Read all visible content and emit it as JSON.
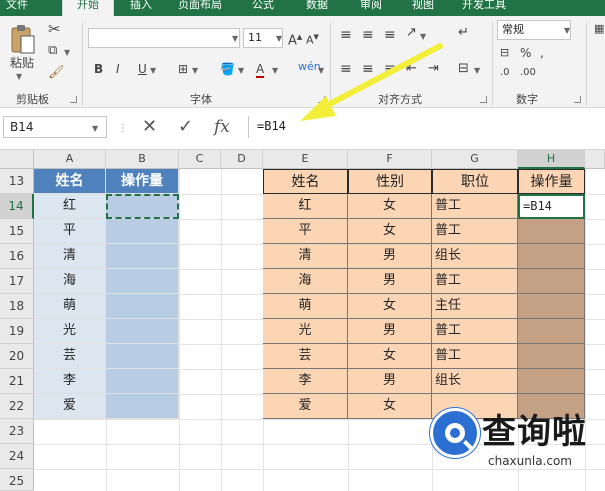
{
  "ribbon": {
    "tabs": [
      "文件",
      "开始",
      "插入",
      "页面布局",
      "公式",
      "数据",
      "审阅",
      "视图",
      "开发工具"
    ],
    "active_tab": "开始",
    "groups": {
      "clipboard": "剪贴板",
      "paste": "粘贴",
      "font": "字体",
      "alignment": "对齐方式",
      "number": "数字"
    },
    "font_size": "11",
    "number_format": "常规"
  },
  "formula_bar": {
    "name_box": "B14",
    "formula": "=B14",
    "fx_label": "fx"
  },
  "columns": [
    "A",
    "B",
    "C",
    "D",
    "E",
    "F",
    "G",
    "H"
  ],
  "selected_column": "H",
  "rows": [
    "13",
    "14",
    "15",
    "16",
    "17",
    "18",
    "19",
    "20",
    "21",
    "22",
    "23",
    "24",
    "25"
  ],
  "selected_row": "14",
  "left_table": {
    "headers": [
      "姓名",
      "操作量"
    ],
    "names": [
      "红",
      "平",
      "清",
      "海",
      "萌",
      "光",
      "芸",
      "李",
      "爱"
    ]
  },
  "right_table": {
    "headers": [
      "姓名",
      "性别",
      "职位",
      "操作量"
    ],
    "rows": [
      {
        "name": "红",
        "gender": "女",
        "title": "普工",
        "op": "=B14"
      },
      {
        "name": "平",
        "gender": "女",
        "title": "普工",
        "op": ""
      },
      {
        "name": "清",
        "gender": "男",
        "title": "组长",
        "op": ""
      },
      {
        "name": "海",
        "gender": "男",
        "title": "普工",
        "op": ""
      },
      {
        "name": "萌",
        "gender": "女",
        "title": "主任",
        "op": ""
      },
      {
        "name": "光",
        "gender": "男",
        "title": "普工",
        "op": ""
      },
      {
        "name": "芸",
        "gender": "女",
        "title": "普工",
        "op": ""
      },
      {
        "name": "李",
        "gender": "男",
        "title": "组长",
        "op": ""
      },
      {
        "name": "爱",
        "gender": "女",
        "title": "",
        "op": ""
      }
    ]
  },
  "watermark": {
    "text": "查询啦",
    "url": "chaxunla.com"
  },
  "colors": {
    "excel_green": "#217346",
    "header_blue": "#4f81bd",
    "light_blue": "#dce6f1",
    "mid_blue": "#b8cce4",
    "peach": "#fcd5b4",
    "brown": "#c4a085",
    "arrow_yellow": "#f2ee3a"
  }
}
